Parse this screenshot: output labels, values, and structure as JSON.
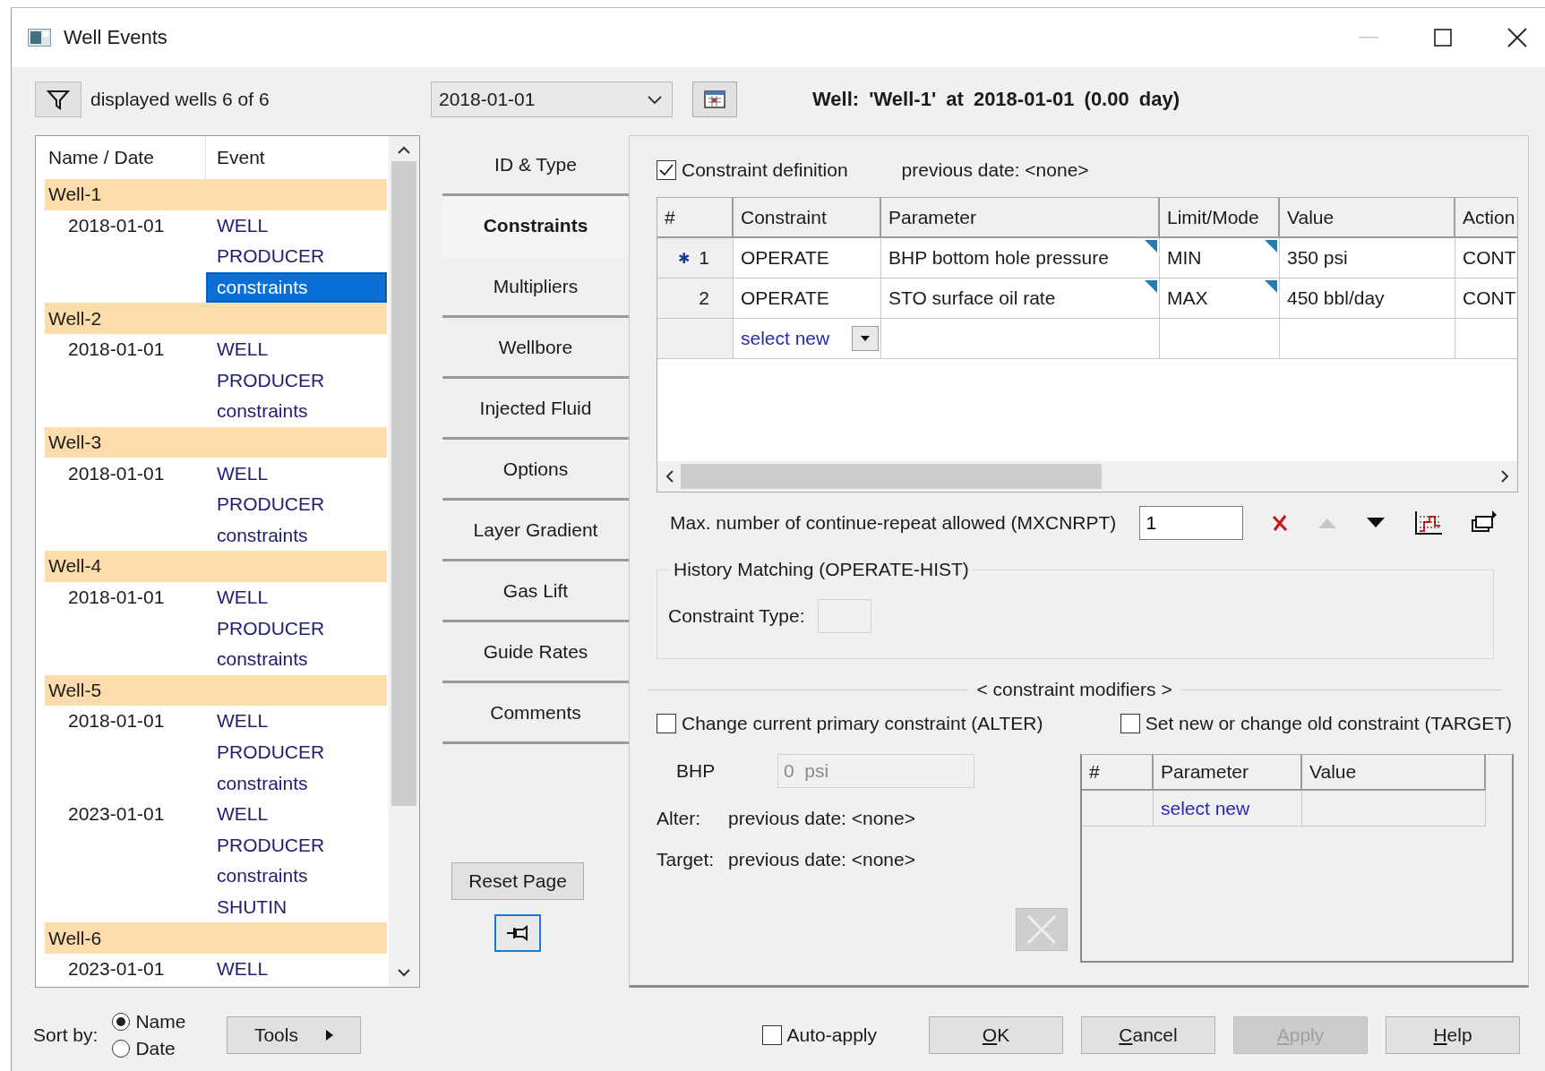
{
  "window": {
    "title": "Well Events"
  },
  "toolbar": {
    "filter_text": "displayed wells 6 of 6",
    "date": "2018-01-01",
    "heading": "Well:  'Well-1'  at  2018-01-01 (0.00 day)"
  },
  "tree": {
    "columns": [
      "Name / Date",
      "Event"
    ],
    "wells": [
      {
        "name": "Well-1",
        "dates": [
          {
            "date": "2018-01-01",
            "events": [
              {
                "label": "WELL",
                "selected": false
              },
              {
                "label": "PRODUCER",
                "selected": false
              },
              {
                "label": "constraints",
                "selected": true
              }
            ]
          }
        ]
      },
      {
        "name": "Well-2",
        "dates": [
          {
            "date": "2018-01-01",
            "events": [
              {
                "label": "WELL",
                "selected": false
              },
              {
                "label": "PRODUCER",
                "selected": false
              },
              {
                "label": "constraints",
                "selected": false
              }
            ]
          }
        ]
      },
      {
        "name": "Well-3",
        "dates": [
          {
            "date": "2018-01-01",
            "events": [
              {
                "label": "WELL",
                "selected": false
              },
              {
                "label": "PRODUCER",
                "selected": false
              },
              {
                "label": "constraints",
                "selected": false
              }
            ]
          }
        ]
      },
      {
        "name": "Well-4",
        "dates": [
          {
            "date": "2018-01-01",
            "events": [
              {
                "label": "WELL",
                "selected": false
              },
              {
                "label": "PRODUCER",
                "selected": false
              },
              {
                "label": "constraints",
                "selected": false
              }
            ]
          }
        ]
      },
      {
        "name": "Well-5",
        "dates": [
          {
            "date": "2018-01-01",
            "events": [
              {
                "label": "WELL",
                "selected": false
              },
              {
                "label": "PRODUCER",
                "selected": false
              },
              {
                "label": "constraints",
                "selected": false
              }
            ]
          },
          {
            "date": "2023-01-01",
            "events": [
              {
                "label": "WELL",
                "selected": false
              },
              {
                "label": "PRODUCER",
                "selected": false
              },
              {
                "label": "constraints",
                "selected": false
              },
              {
                "label": "SHUTIN",
                "selected": false
              }
            ]
          }
        ]
      },
      {
        "name": "Well-6",
        "dates": [
          {
            "date": "2023-01-01",
            "events": [
              {
                "label": "WELL",
                "selected": false
              }
            ]
          }
        ]
      }
    ]
  },
  "tabs": [
    {
      "label": "ID & Type",
      "selected": false
    },
    {
      "label": "Constraints",
      "selected": true
    },
    {
      "label": "Multipliers",
      "selected": false
    },
    {
      "label": "Wellbore",
      "selected": false
    },
    {
      "label": "Injected Fluid",
      "selected": false
    },
    {
      "label": "Options",
      "selected": false
    },
    {
      "label": "Layer Gradient",
      "selected": false
    },
    {
      "label": "Gas Lift",
      "selected": false
    },
    {
      "label": "Guide Rates",
      "selected": false
    },
    {
      "label": "Comments",
      "selected": false
    }
  ],
  "reset_button": "Reset Page",
  "constraint_definition": {
    "label": "Constraint definition",
    "checked": true,
    "previous_date": "previous date: <none>"
  },
  "constraints_table": {
    "columns": [
      "#",
      "Constraint",
      "Parameter",
      "Limit/Mode",
      "Value",
      "Action"
    ],
    "rows": [
      {
        "marker": "✱",
        "number": "1",
        "constraint": "OPERATE",
        "parameter": "BHP bottom hole pressure",
        "limit_mode": "MIN",
        "value": "350  psi",
        "action": "CONT"
      },
      {
        "number": "2",
        "constraint": "OPERATE",
        "parameter": "STO surface oil rate",
        "limit_mode": "MAX",
        "value": "450  bbl/day",
        "action": "CONT"
      }
    ],
    "new_row": "select new"
  },
  "max_repeat": {
    "label": "Max. number of continue-repeat allowed (MXCNRPT)",
    "value": "1"
  },
  "history_matching": {
    "title": "History Matching (OPERATE-HIST)",
    "constraint_type_label": "Constraint Type:"
  },
  "modifiers": {
    "title": "< constraint modifiers >",
    "alter": {
      "label": "Change current primary constraint (ALTER)",
      "checked": false
    },
    "target": {
      "label": "Set new or change old constraint (TARGET)",
      "checked": false
    },
    "bhp_label": "BHP",
    "bhp_value": "0  psi",
    "alter_label": "Alter:",
    "alter_text": "previous date: <none>",
    "target_label": "Target:",
    "target_text": "previous date: <none>",
    "table": {
      "columns": [
        "#",
        "Parameter",
        "Value"
      ],
      "new_row": "select new"
    }
  },
  "sort": {
    "label": "Sort by:",
    "options": [
      {
        "label": "Name",
        "selected": true
      },
      {
        "label": "Date",
        "selected": false
      }
    ]
  },
  "tools_button": "Tools",
  "auto_apply": {
    "label": "Auto-apply",
    "checked": false
  },
  "buttons": [
    {
      "label": "OK",
      "disabled": false,
      "mnemonic": true
    },
    {
      "label": "Cancel",
      "disabled": false,
      "mnemonic": true
    },
    {
      "label": "Apply",
      "disabled": true,
      "mnemonic": true
    },
    {
      "label": "Help",
      "disabled": false,
      "mnemonic": true
    }
  ]
}
